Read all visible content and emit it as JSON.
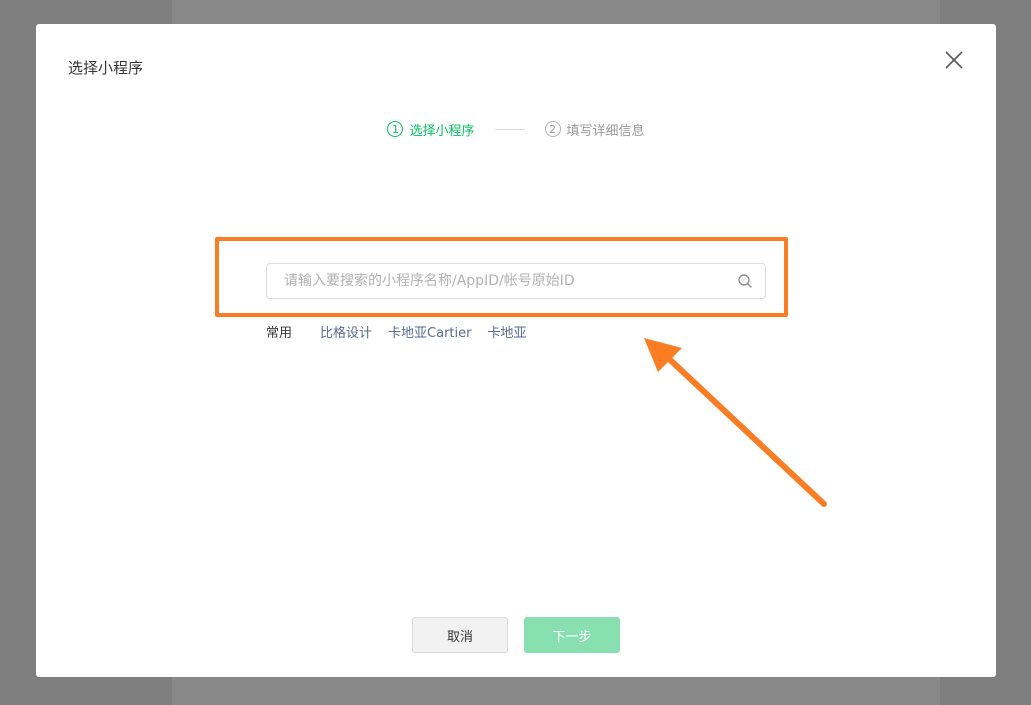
{
  "dialog": {
    "title": "选择小程序"
  },
  "steps": [
    {
      "number": "1",
      "label": "选择小程序",
      "state": "active"
    },
    {
      "number": "2",
      "label": "填写详细信息",
      "state": "inactive"
    }
  ],
  "search": {
    "placeholder": "请输入要搜索的小程序名称/AppID/帐号原始ID",
    "value": ""
  },
  "quick_links": {
    "label": "常用",
    "items": [
      "比格设计",
      "卡地亚Cartier",
      "卡地亚"
    ]
  },
  "footer": {
    "cancel_label": "取消",
    "next_label": "下一步"
  },
  "colors": {
    "accent": "#07c160",
    "highlight": "#fa7d24",
    "link": "#576b95",
    "next_disabled": "#88e0b0"
  },
  "icons": {
    "close": "close-icon",
    "search": "search-icon",
    "annotation_arrow": "arrow-icon"
  }
}
